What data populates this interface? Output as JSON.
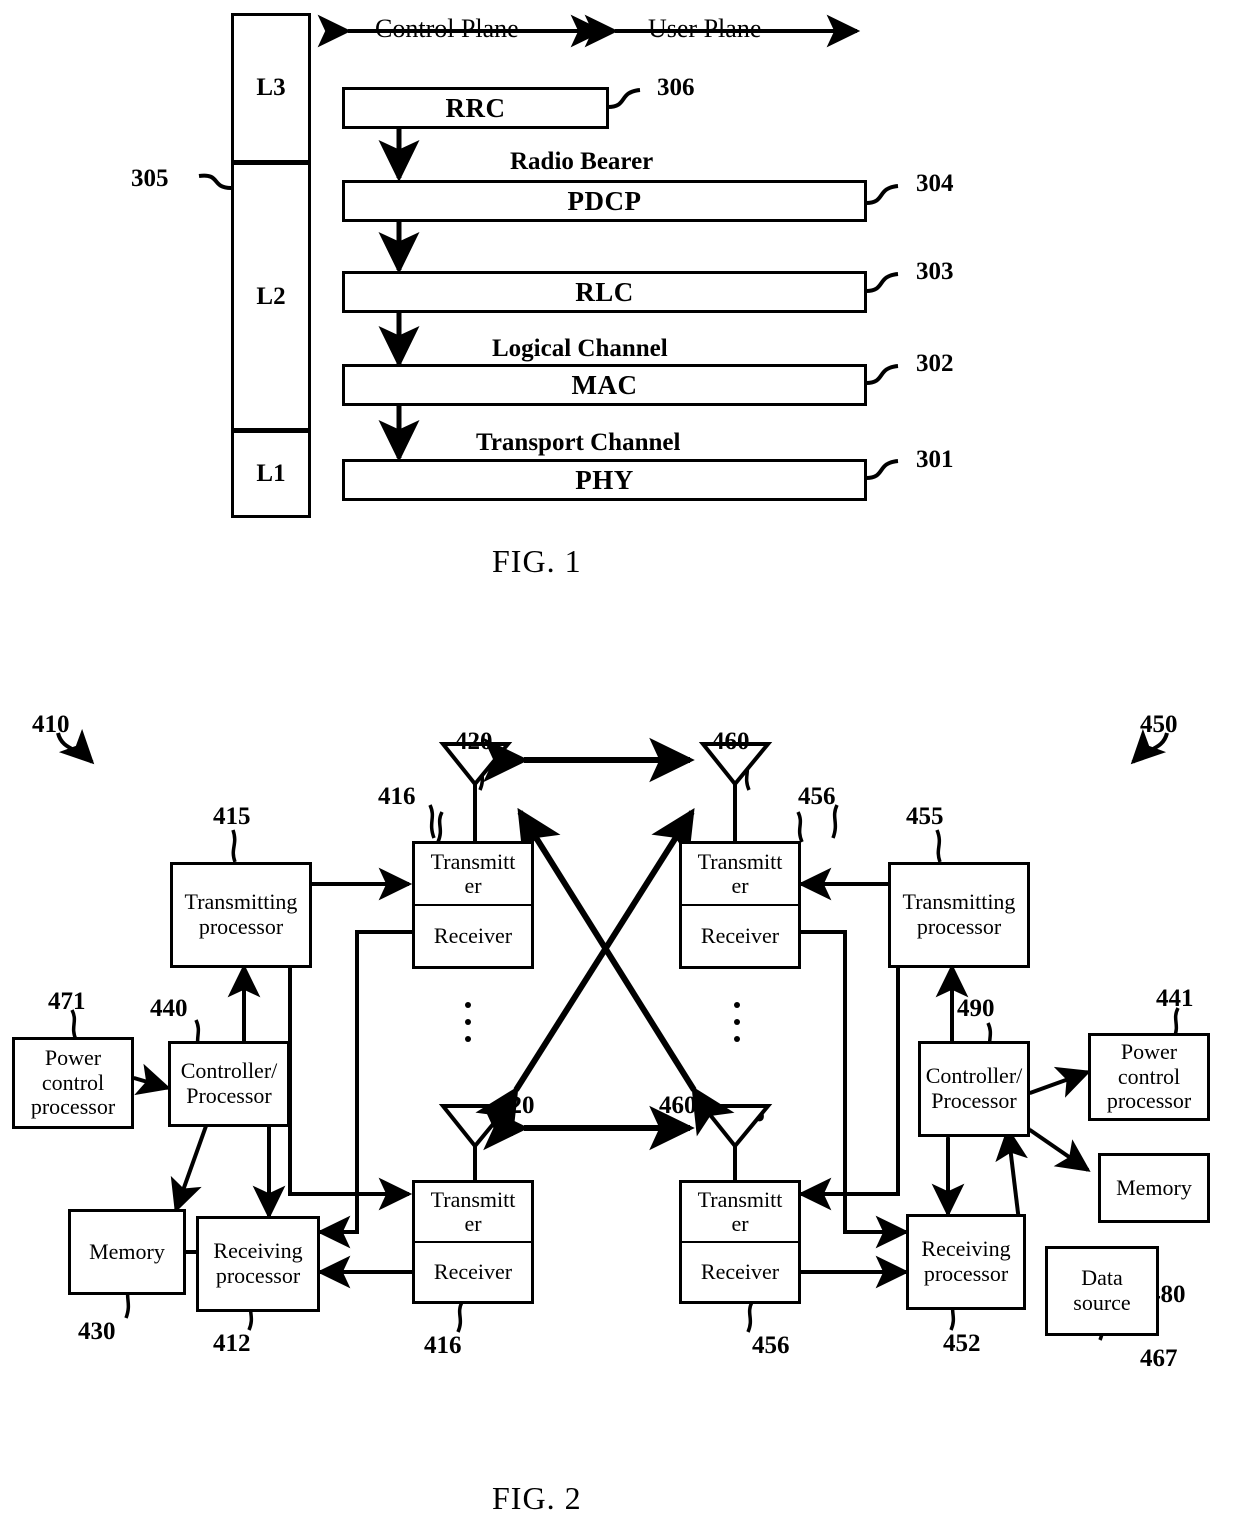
{
  "figure1": {
    "caption": "FIG. 1",
    "plane_labels": {
      "control": "Control Plane",
      "user": "User Plane"
    },
    "layer_column": {
      "ref": "305",
      "cells": [
        {
          "label": "L3"
        },
        {
          "label": "L2"
        },
        {
          "label": "L1"
        }
      ]
    },
    "protocol_bars": [
      {
        "label": "RRC",
        "ref": "306"
      },
      {
        "label": "PDCP",
        "ref": "304"
      },
      {
        "label": "RLC",
        "ref": "303"
      },
      {
        "label": "MAC",
        "ref": "302"
      },
      {
        "label": "PHY",
        "ref": "301"
      }
    ],
    "channel_labels": [
      {
        "label": "Radio Bearer"
      },
      {
        "label": "Logical Channel"
      },
      {
        "label": "Transport Channel"
      }
    ]
  },
  "figure2": {
    "caption": "FIG. 2",
    "refs": {
      "left_node": "410",
      "right_node": "450",
      "left_tx_processor": "415",
      "left_controller": "440",
      "left_power_control": "471",
      "left_memory": "430",
      "left_rx_processor": "412",
      "left_trx_top": "416",
      "left_trx_bottom": "416",
      "left_antenna_top": "420",
      "left_antenna_bottom": "420",
      "right_tx_processor": "455",
      "right_controller": "490",
      "right_power_control": "441",
      "right_memory": "480",
      "right_rx_processor": "452",
      "right_data_source": "467",
      "right_trx_top": "456",
      "right_trx_bottom": "456",
      "right_antenna_top": "460",
      "right_antenna_bottom": "460"
    },
    "left": {
      "transmitting_processor": "Transmitting\nprocessor",
      "transmitting_processor_l1": "Transmitting",
      "transmitting_processor_l2": "processor",
      "controller_l1": "Controller/",
      "controller_l2": "Processor",
      "power_control_l1": "Power",
      "power_control_l2": "control",
      "power_control_l3": "processor",
      "memory": "Memory",
      "receiving_processor_l1": "Receiving",
      "receiving_processor_l2": "processor",
      "transmitter_l1": "Transmitt",
      "transmitter_l2": "er",
      "receiver": "Receiver"
    },
    "right": {
      "transmitting_processor_l1": "Transmitting",
      "transmitting_processor_l2": "processor",
      "controller_l1": "Controller/",
      "controller_l2": "Processor",
      "power_control_l1": "Power",
      "power_control_l2": "control",
      "power_control_l3": "processor",
      "memory": "Memory",
      "receiving_processor_l1": "Receiving",
      "receiving_processor_l2": "processor",
      "data_source_l1": "Data",
      "data_source_l2": "source",
      "transmitter_l1": "Transmitt",
      "transmitter_l2": "er",
      "receiver": "Receiver"
    }
  },
  "colors": {
    "ink": "#000000",
    "paper": "#ffffff"
  }
}
